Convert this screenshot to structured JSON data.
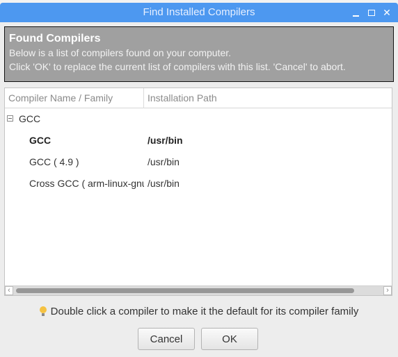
{
  "window": {
    "title": "Find Installed Compilers",
    "controls": {
      "minimize": "minimize",
      "maximize": "maximize",
      "close": "✕"
    }
  },
  "header": {
    "title": "Found Compilers",
    "line1": "Below is a list of compilers found on your computer.",
    "line2": "Click 'OK' to replace the current list of compilers with this list. 'Cancel' to abort."
  },
  "tree": {
    "columns": [
      "Compiler Name / Family",
      "Installation Path"
    ],
    "families": [
      {
        "name": "GCC",
        "expanded": true,
        "compilers": [
          {
            "name": "GCC",
            "path": "/usr/bin",
            "default": true
          },
          {
            "name": "GCC ( 4.9 )",
            "path": "/usr/bin",
            "default": false
          },
          {
            "name": "Cross GCC ( arm-linux-gnueabihf )",
            "path": "/usr/bin",
            "default": false
          }
        ]
      }
    ]
  },
  "hint": "Double click a compiler to make it the default for its compiler family",
  "buttons": {
    "cancel": "Cancel",
    "ok": "OK"
  },
  "colors": {
    "titlebar": "#4d98f0",
    "header_panel": "#a0a0a0",
    "hint_icon": "#f5c242"
  }
}
